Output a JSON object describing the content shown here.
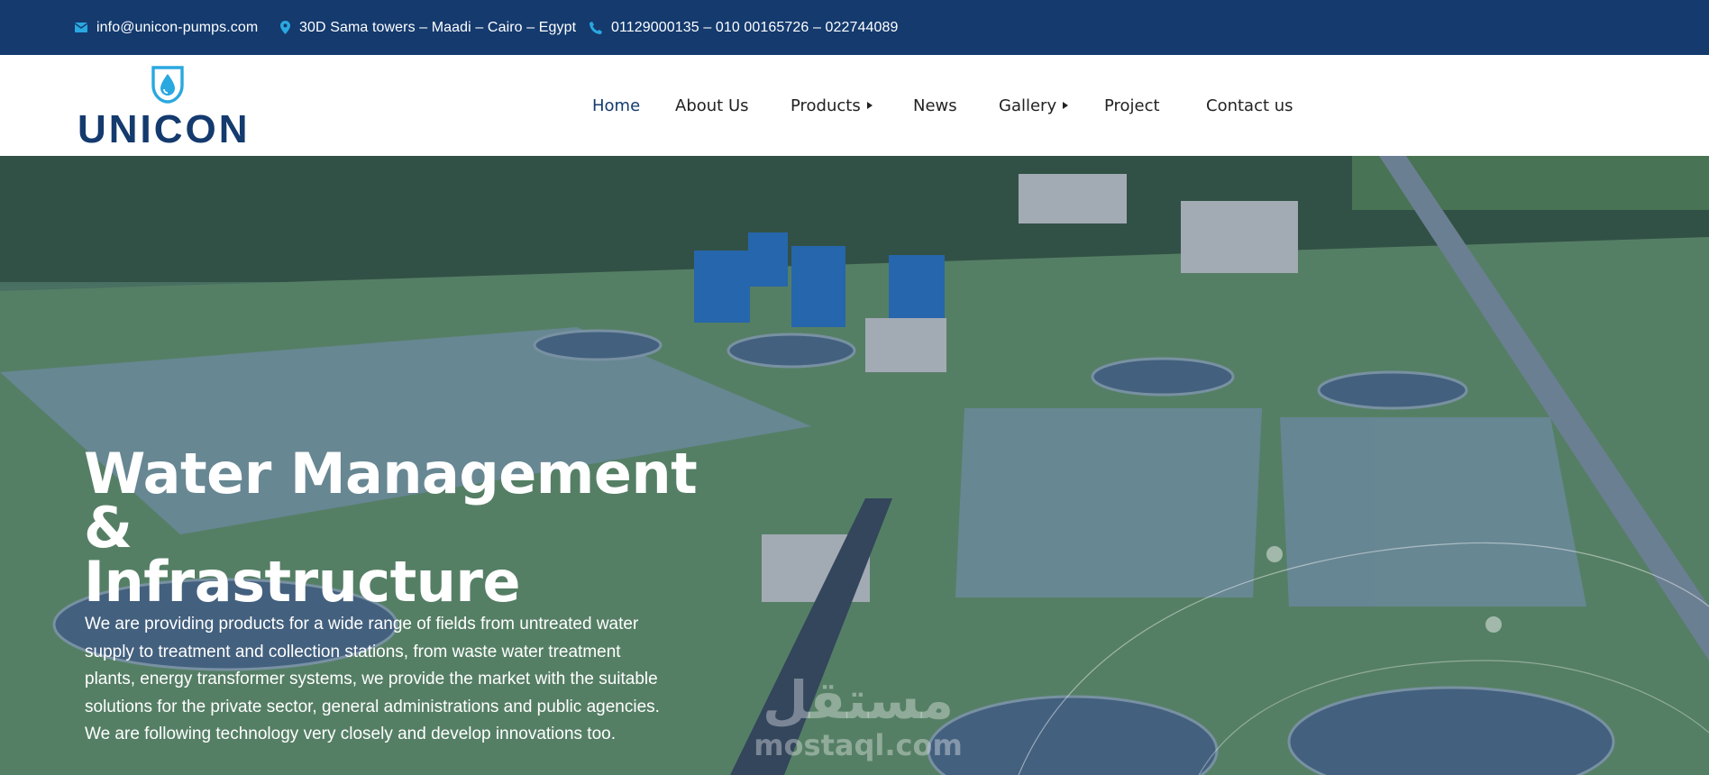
{
  "topbar": {
    "email": "info@unicon-pumps.com",
    "address": "30D Sama towers – Maadi – Cairo – Egypt",
    "phone": "01129000135 – 010 00165726 – 022744089"
  },
  "social": [
    {
      "icon": "facebook-icon"
    },
    {
      "icon": "instagram-icon"
    },
    {
      "icon": "linkedin-icon"
    }
  ],
  "logo": {
    "text": "UNICON"
  },
  "nav": {
    "items": [
      {
        "label": "Home",
        "active": true
      },
      {
        "label": "About Us"
      },
      {
        "label": "Products",
        "has_submenu": true
      },
      {
        "label": "News"
      },
      {
        "label": "Gallery",
        "has_submenu": true
      },
      {
        "label": "Project"
      },
      {
        "label": "Contact us"
      }
    ]
  },
  "hero": {
    "title_line1": "Water Management &",
    "title_line2": "Infrastructure",
    "text": "We are providing products for a wide range of fields from untreated water supply to treatment and collection stations, from waste water treatment plants, energy transformer systems, we provide the market with the suitable solutions for the private sector, general administrations and public agencies. We are following technology very closely and develop innovations too."
  },
  "watermark": {
    "arabic": "مستقل",
    "latin": "mostaql.com"
  },
  "colors": {
    "brand": "#143a6e",
    "accent": "#2aa8e0"
  }
}
